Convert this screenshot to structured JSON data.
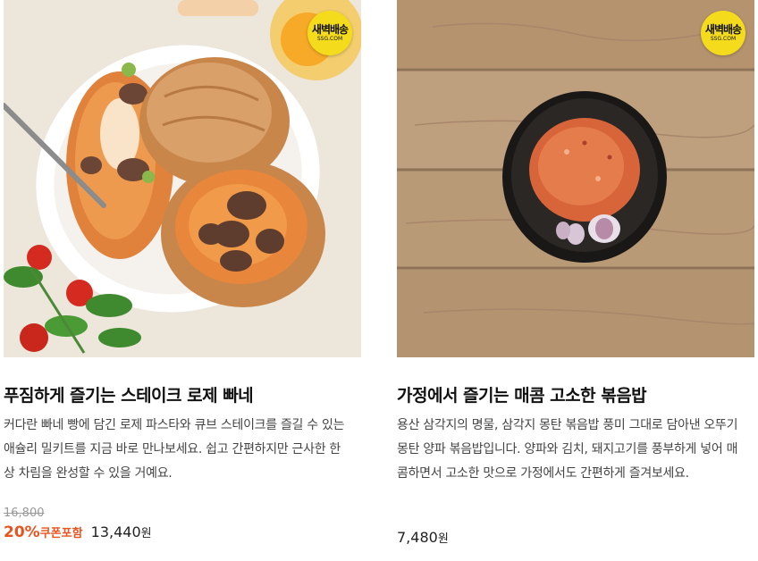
{
  "products": [
    {
      "title": "푸짐하게 즐기는 스테이크 로제 빠네",
      "description": "커다란 빠네 빵에 담긴 로제 파스타와 큐브 스테이크를 즐길 수 있는 애슐리 밀키트를 지금 바로 만나보세요. 쉽고 간편하지만 근사한 한 상 차림을 완성할 수 있을 거예요.",
      "badge": {
        "line1": "새벽배송",
        "line2": "SSG.COM"
      },
      "original_price": "16,800",
      "discount": "20%",
      "coupon_label": "쿠폰포함",
      "price": "13,440",
      "currency": "원",
      "image": "rose-pasta-bread-bowl-steak-photo"
    },
    {
      "title": "가정에서 즐기는 매콤 고소한 볶음밥",
      "description": "용산 삼각지의 명물, 삼각지 몽탄 볶음밥 풍미 그대로 담아낸 오뚜기 몽탄 양파 볶음밥입니다. 양파와 김치, 돼지고기를 풍부하게 넣어 매콤하면서 고소한 맛으로 가정에서도 간편하게 즐겨보세요.",
      "badge": {
        "line1": "새벽배송",
        "line2": "SSG.COM"
      },
      "price": "7,480",
      "currency": "원",
      "image": "onion-fried-rice-black-bowl-photo"
    }
  ],
  "colors": {
    "discount": "#e8531e",
    "badge": "#f4dc1c",
    "wood": "#b89a78"
  }
}
